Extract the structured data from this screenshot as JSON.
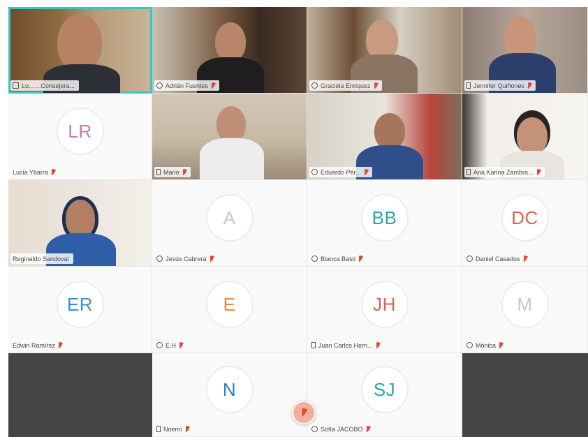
{
  "participants": [
    {
      "name": "Lu... ...Consejera...",
      "kind": "video",
      "active": true
    },
    {
      "name": "Adrián Fuentes",
      "kind": "video"
    },
    {
      "name": "Graciela Enriquez",
      "kind": "video"
    },
    {
      "name": "Jennifer Quiñones",
      "kind": "video"
    },
    {
      "name": "Lucia Ybarra",
      "kind": "avatar",
      "initials": "LR",
      "color": "#c27ca6"
    },
    {
      "name": "Mario",
      "kind": "video"
    },
    {
      "name": "Eduardo Pér...",
      "kind": "video"
    },
    {
      "name": "Ana Karina Zambra...",
      "kind": "video"
    },
    {
      "name": "Reginaldo Sandoval",
      "kind": "video"
    },
    {
      "name": "Jesús Cabrera",
      "kind": "avatar",
      "initials": "A",
      "color": "#c8c8c8"
    },
    {
      "name": "Blanca Basti",
      "kind": "avatar",
      "initials": "BB",
      "color": "#2aa7a0"
    },
    {
      "name": "Daniel Casados",
      "kind": "avatar",
      "initials": "DC",
      "color": "#e0604f"
    },
    {
      "name": "Edwin Ramírez",
      "kind": "avatar",
      "initials": "ER",
      "color": "#3c8fd4"
    },
    {
      "name": "E.H",
      "kind": "avatar",
      "initials": "E",
      "color": "#e8873a"
    },
    {
      "name": "Juan Carlos Hern...",
      "kind": "avatar",
      "initials": "JH",
      "color": "#e0604f"
    },
    {
      "name": "Mónica",
      "kind": "avatar",
      "initials": "M",
      "color": "#c8c8c8"
    },
    {
      "name": "",
      "kind": "empty"
    },
    {
      "name": "Noemí",
      "kind": "avatar",
      "initials": "N",
      "color": "#2c7fc4"
    },
    {
      "name": "Sofía JACOBO",
      "kind": "avatar",
      "initials": "SJ",
      "color": "#2aa7a0"
    },
    {
      "name": "",
      "kind": "empty"
    }
  ],
  "icons": {
    "mic": "mic-muted-icon",
    "device_desktop": "desktop-icon",
    "device_phone": "phone-icon"
  }
}
